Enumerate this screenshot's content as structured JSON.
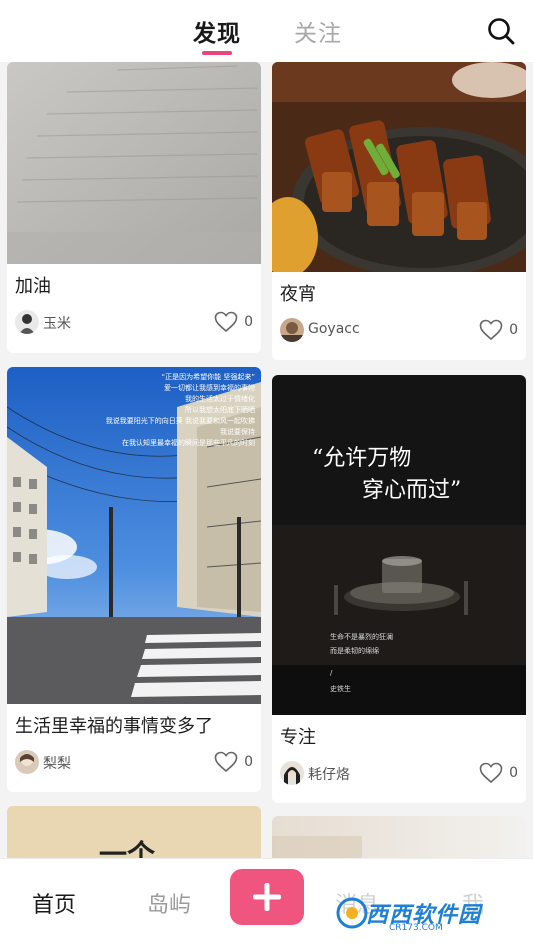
{
  "header": {
    "tabs": [
      {
        "label": "发现",
        "active": true
      },
      {
        "label": "关注",
        "active": false
      }
    ],
    "search_icon": "search-icon",
    "accent_color": "#e8457a"
  },
  "feed": {
    "cards": [
      {
        "title": "加油",
        "author": "玉米",
        "likes": "0",
        "image": "book-page-photo"
      },
      {
        "title": "夜宵",
        "author": "Goyacc",
        "likes": "0",
        "image": "bbq-skewers-photo"
      },
      {
        "title": "生活里幸福的事情变多了",
        "author": "梨梨",
        "likes": "0",
        "image": "street-sky-photo",
        "overlay_lines": [
          "“正是因为希望你能 坚强起来”",
          "爱一切都让我感到幸福的事物",
          "我的生活太过于情绪化",
          "所以我想太阳底下晒晒",
          "我说我要阳光下的向日葵 我说我要和风一起吹拂",
          "我说要保持",
          "在我认知里最幸福的瞬间是那些平凡的时刻"
        ]
      },
      {
        "title": "专注",
        "author": "耗仔烙",
        "likes": "0",
        "image": "glass-on-table-photo",
        "quote_line1": "“允许万物",
        "quote_line2": "穿心而过”",
        "small_line1": "生命不是暴烈的狂澜",
        "small_line2": "而是柔韧的绵绵",
        "small_author": "史铁生"
      },
      {
        "image": "partial-card-beige",
        "peek_text": "一个"
      },
      {
        "image": "partial-card-light"
      }
    ]
  },
  "bottom_nav": {
    "items": [
      "首页",
      "岛屿",
      "消息",
      "我"
    ],
    "active_index": 0,
    "add_icon": "plus-icon",
    "add_color": "#f0557f"
  },
  "watermark": {
    "text": "西西软件园",
    "url": "CR173.COM"
  }
}
